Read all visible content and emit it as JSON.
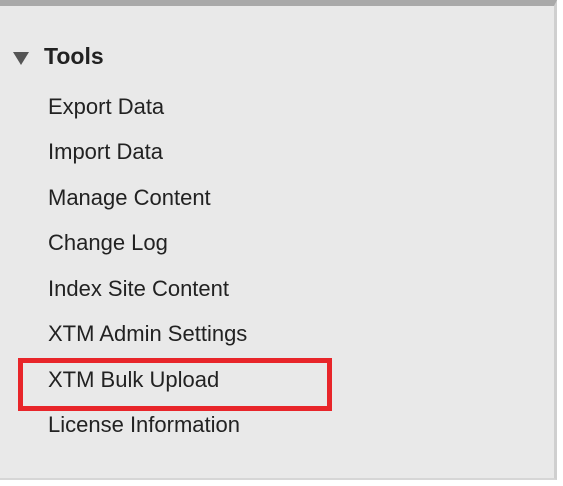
{
  "tools_section": {
    "title": "Tools",
    "expanded": true,
    "caret_icon": "triangle-down-icon",
    "items": [
      {
        "label": "Export Data"
      },
      {
        "label": "Import Data"
      },
      {
        "label": "Manage Content"
      },
      {
        "label": "Change Log"
      },
      {
        "label": "Index Site Content"
      },
      {
        "label": "XTM Admin Settings"
      },
      {
        "label": "XTM Bulk Upload",
        "highlighted": true
      },
      {
        "label": "License Information"
      }
    ]
  },
  "colors": {
    "panel_background": "#e9e9e9",
    "panel_top_border": "#a9a9a9",
    "text": "#222222",
    "highlight_border": "#e8252a"
  }
}
